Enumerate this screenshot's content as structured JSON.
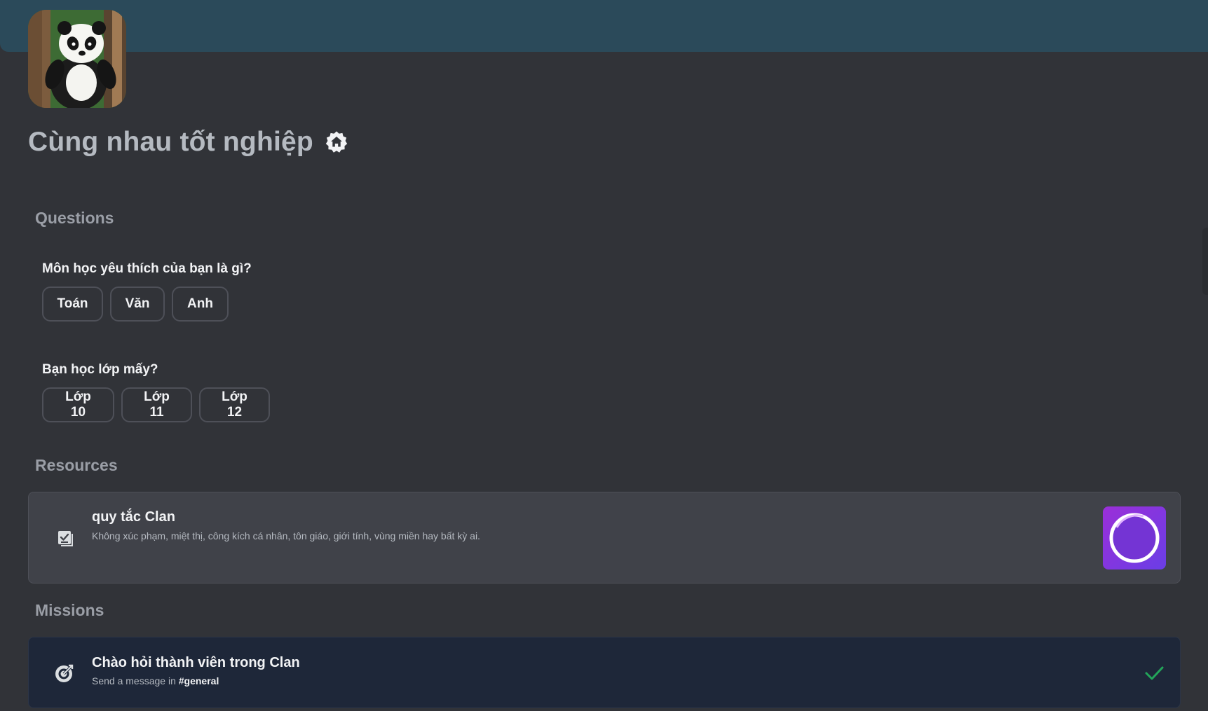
{
  "clan": {
    "name": "Cùng nhau tốt nghiệp",
    "avatar": "panda-photo",
    "badge_icon": "home-badge-icon",
    "banner_color": "#2b4a5a"
  },
  "sections": {
    "questions": "Questions",
    "resources": "Resources",
    "missions": "Missions"
  },
  "questions": [
    {
      "label": "Môn học yêu thích của bạn là gì?",
      "options": [
        "Toán",
        "Văn",
        "Anh"
      ]
    },
    {
      "label": "Bạn học lớp mấy?",
      "options": [
        "Lớp 10",
        "Lớp 11",
        "Lớp 12"
      ]
    }
  ],
  "resource": {
    "title": "quy tắc Clan",
    "description": "Không xúc phạm, miệt thị, công kích cá nhân, tôn giáo, giới tính, vùng miền hay bất kỳ ai.",
    "icon": "checklist-icon",
    "thumbnail": "circle-ring-thumbnail"
  },
  "mission": {
    "title": "Chào hỏi thành viên trong Clan",
    "sub_prefix": "Send a message in",
    "channel": "#general",
    "icon": "target-icon",
    "status_icon": "checkmark-icon",
    "status_color": "#23a55a"
  }
}
